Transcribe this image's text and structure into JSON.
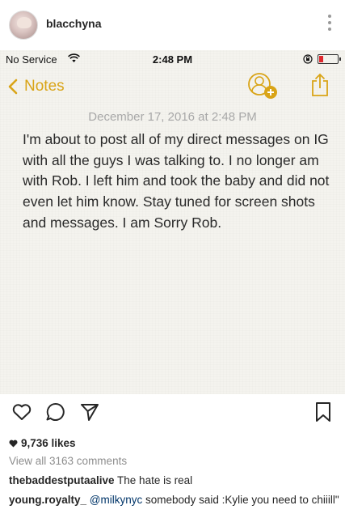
{
  "post": {
    "username": "blacchyna",
    "likes": "9,736 likes",
    "view_comments": "View all 3163 comments"
  },
  "phone": {
    "carrier": "No Service",
    "time": "2:48 PM",
    "back_label": "Notes",
    "note_date": "December 17, 2016 at 2:48 PM",
    "note_text": "I'm about to post all of my direct messages on IG with all the guys I was talking to. I no longer am with Rob. I left him and took the baby and did not even let him know. Stay tuned for screen shots and messages. I am Sorry Rob."
  },
  "comments": [
    {
      "user": "thebaddestputaalive",
      "mention": "",
      "text": "The hate is real"
    },
    {
      "user": "young.royalty_",
      "mention": "@milkynyc",
      "text": "somebody said :Kylie you need to chiiill\""
    }
  ],
  "colors": {
    "notes_accent": "#d9a417",
    "battery": "#e0282e",
    "mention": "#003569"
  }
}
